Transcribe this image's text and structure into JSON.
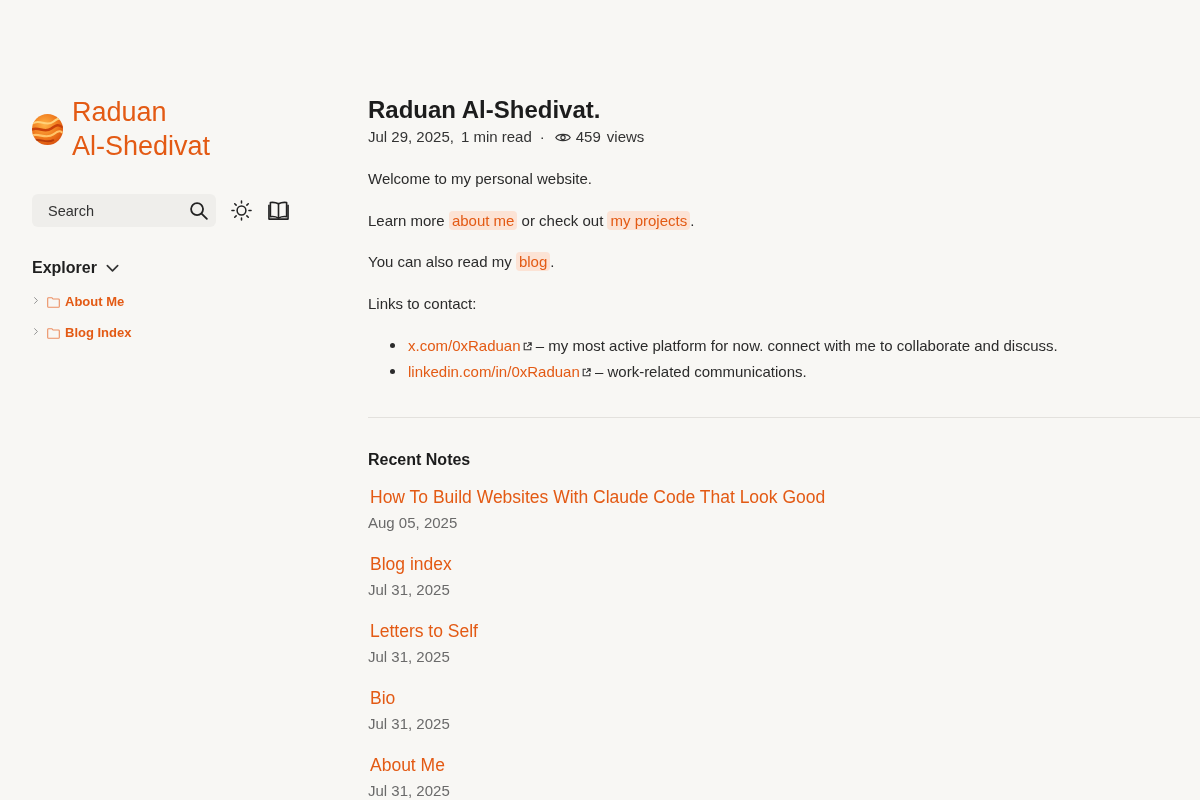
{
  "sidebar": {
    "site_title": "Raduan Al-Shedivat",
    "search": {
      "placeholder": "Search"
    },
    "explorer": {
      "title": "Explorer",
      "expanded": true,
      "items": [
        {
          "label": "About Me",
          "expanded": false
        },
        {
          "label": "Blog Index",
          "expanded": false
        }
      ]
    }
  },
  "article": {
    "title": "Raduan Al-Shedivat.",
    "meta": {
      "date": "Jul 29, 2025,",
      "read_time": "1 min read",
      "separator": "·",
      "views_count": "459",
      "views_label": "views"
    },
    "paragraphs": [
      [
        {
          "kind": "text",
          "text": "Welcome to my personal website."
        }
      ],
      [
        {
          "kind": "text",
          "text": "Learn more "
        },
        {
          "kind": "link",
          "text": "about me"
        },
        {
          "kind": "text",
          "text": " or check out "
        },
        {
          "kind": "link",
          "text": "my projects"
        },
        {
          "kind": "text",
          "text": "."
        }
      ],
      [
        {
          "kind": "text",
          "text": "You can also read my "
        },
        {
          "kind": "link",
          "text": "blog"
        },
        {
          "kind": "text",
          "text": "."
        }
      ],
      [
        {
          "kind": "text",
          "text": "Links to contact:"
        }
      ]
    ],
    "contacts": [
      {
        "link": "x.com/0xRaduan",
        "text": "– my most active platform for now. connect with me to collaborate and discuss."
      },
      {
        "link": "linkedin.com/in/0xRaduan",
        "text": "– work-related communications."
      }
    ]
  },
  "recent_notes": {
    "title": "Recent Notes",
    "notes": [
      {
        "title": "How To Build Websites With Claude Code That Look Good",
        "date": "Aug 05, 2025"
      },
      {
        "title": "Blog index",
        "date": "Jul 31, 2025"
      },
      {
        "title": "Letters to Self",
        "date": "Jul 31, 2025"
      },
      {
        "title": "Bio",
        "date": "Jul 31, 2025"
      },
      {
        "title": "About Me",
        "date": "Jul 31, 2025"
      }
    ]
  }
}
